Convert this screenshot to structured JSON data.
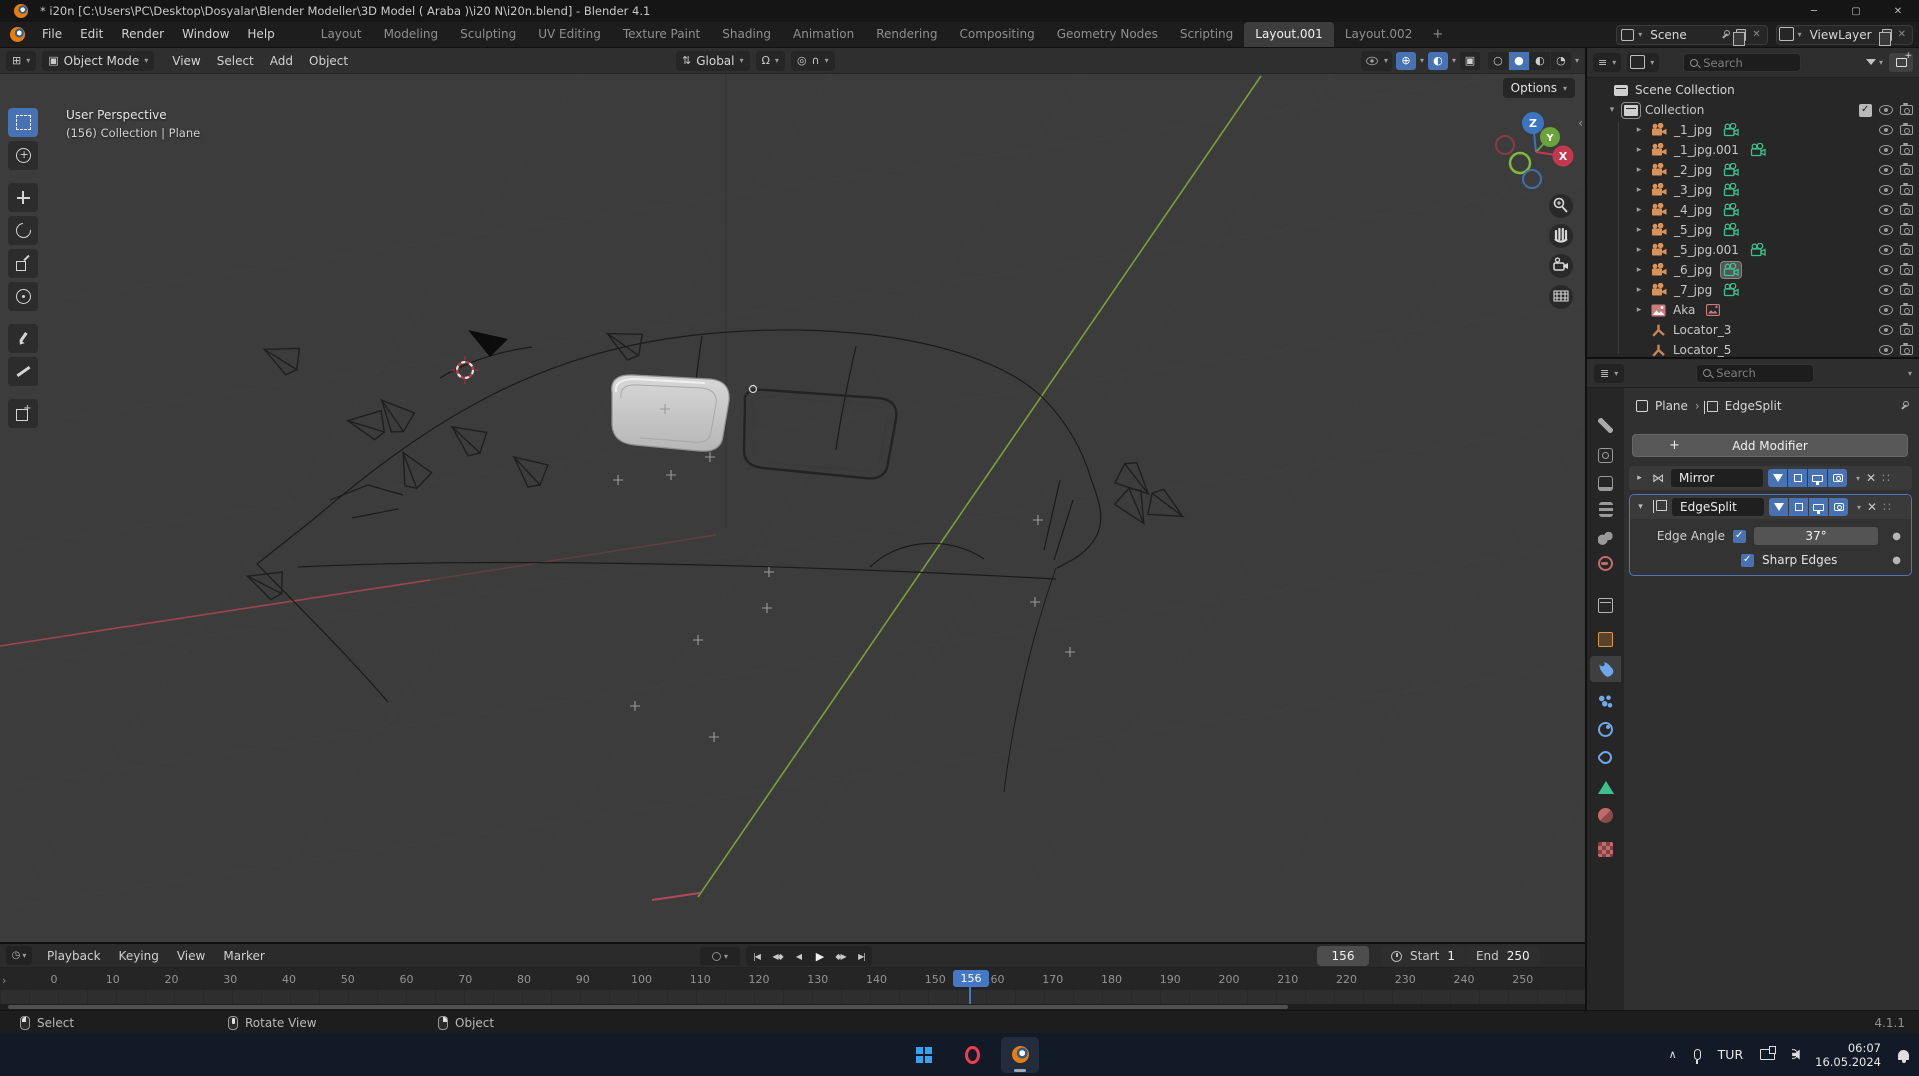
{
  "window": {
    "title": "* i20n [C:\\Users\\PC\\Desktop\\Dosyalar\\Blender Modeller\\3D Model ( Araba )\\i20 N\\i20n.blend] - Blender 4.1",
    "controls": {
      "minimize": "─",
      "maximize": "▢",
      "close": "✕"
    }
  },
  "menubar": {
    "menus": [
      "File",
      "Edit",
      "Render",
      "Window",
      "Help"
    ]
  },
  "workspaces": {
    "tabs": [
      {
        "label": "Layout",
        "state": ""
      },
      {
        "label": "Modeling",
        "state": ""
      },
      {
        "label": "Sculpting",
        "state": ""
      },
      {
        "label": "UV Editing",
        "state": ""
      },
      {
        "label": "Texture Paint",
        "state": ""
      },
      {
        "label": "Shading",
        "state": ""
      },
      {
        "label": "Animation",
        "state": ""
      },
      {
        "label": "Rendering",
        "state": ""
      },
      {
        "label": "Compositing",
        "state": ""
      },
      {
        "label": "Geometry Nodes",
        "state": ""
      },
      {
        "label": "Scripting",
        "state": ""
      },
      {
        "label": "Layout.001",
        "state": "active"
      },
      {
        "label": "Layout.002",
        "state": ""
      }
    ],
    "add_label": "+"
  },
  "scene_selector": {
    "scene_label": "Scene",
    "viewlayer_label": "ViewLayer"
  },
  "viewport": {
    "header": {
      "mode": "Object Mode",
      "menus": [
        "View",
        "Select",
        "Add",
        "Object"
      ],
      "orientation": "Global"
    },
    "options_label": "Options",
    "overlay": {
      "line1": "User Perspective",
      "line2": "(156) Collection | Plane"
    },
    "axis": {
      "x": "X",
      "y": "Y",
      "z": "Z"
    },
    "tools": [
      {
        "icon": "select-box"
      },
      {
        "icon": "cursor"
      },
      {
        "icon": "move"
      },
      {
        "icon": "rotate"
      },
      {
        "icon": "scale"
      },
      {
        "icon": "transform"
      },
      {
        "icon": "annotate"
      },
      {
        "icon": "measure"
      },
      {
        "icon": "add-cube"
      }
    ]
  },
  "outliner": {
    "search_placeholder": "Search",
    "scene_collection_label": "Scene Collection",
    "collection_label": "Collection",
    "items": [
      {
        "label": "_1_jpg",
        "type": "camera",
        "data": "camdata",
        "arrow": "yes",
        "state": ""
      },
      {
        "label": "_1_jpg.001",
        "type": "camera",
        "data": "camdata",
        "arrow": "yes",
        "state": ""
      },
      {
        "label": "_2_jpg",
        "type": "camera",
        "data": "camdata",
        "arrow": "yes",
        "state": ""
      },
      {
        "label": "_3_jpg",
        "type": "camera",
        "data": "camdata",
        "arrow": "yes",
        "state": ""
      },
      {
        "label": "_4_jpg",
        "type": "camera",
        "data": "camdata",
        "arrow": "yes",
        "state": ""
      },
      {
        "label": "_5_jpg",
        "type": "camera",
        "data": "camdata",
        "arrow": "yes",
        "state": ""
      },
      {
        "label": "_5_jpg.001",
        "type": "camera",
        "data": "camdata",
        "arrow": "yes",
        "state": ""
      },
      {
        "label": "_6_jpg",
        "type": "camera",
        "data": "camdata",
        "arrow": "yes",
        "state": "highlight"
      },
      {
        "label": "_7_jpg",
        "type": "camera",
        "data": "camdata",
        "arrow": "yes",
        "state": ""
      },
      {
        "label": "Aka",
        "type": "image",
        "data": "imgdata",
        "arrow": "yes",
        "state": ""
      },
      {
        "label": "Locator_3",
        "type": "empty",
        "data": "",
        "arrow": "no",
        "state": ""
      },
      {
        "label": "Locator_5",
        "type": "empty",
        "data": "",
        "arrow": "no",
        "state": ""
      }
    ]
  },
  "properties": {
    "search_placeholder": "Search",
    "breadcrumb": {
      "object": "Plane",
      "separator": "›",
      "modifier": "EdgeSplit"
    },
    "add_modifier_label": "Add Modifier",
    "modifiers": {
      "mirror_name": "Mirror",
      "edgesplit_name": "EdgeSplit"
    },
    "edge_angle_label": "Edge Angle",
    "edge_angle_value": "37°",
    "sharp_edges_label": "Sharp Edges"
  },
  "timeline": {
    "menus": [
      "Playback",
      "Keying",
      "View",
      "Marker"
    ],
    "transport": [
      "|◀",
      "◀◆",
      "◀",
      "▶",
      "◆▶",
      "▶|"
    ],
    "current_frame": "156",
    "start_label": "Start",
    "start_value": "1",
    "end_label": "End",
    "end_value": "250",
    "ticks": [
      "0",
      "10",
      "20",
      "30",
      "40",
      "50",
      "60",
      "70",
      "80",
      "90",
      "100",
      "110",
      "120",
      "130",
      "140",
      "150",
      "160",
      "170",
      "180",
      "190",
      "200",
      "210",
      "220",
      "230",
      "240",
      "250"
    ]
  },
  "statusbar": {
    "hints": [
      {
        "label": "Select",
        "button": "left"
      },
      {
        "label": "Rotate View",
        "button": "middle"
      },
      {
        "label": "Object",
        "button": "right"
      }
    ],
    "version": "4.1.1"
  },
  "taskbar": {
    "language": "TUR",
    "time": "06:07",
    "date": "16.05.2024"
  },
  "colors": {
    "accent": "#4772b3",
    "blender_orange": "#e87d0d",
    "axis_green": "#7a9e3a",
    "axis_red": "#a8474f",
    "camera_data_green": "#3fbf8f",
    "object_orange": "#d9935a"
  }
}
